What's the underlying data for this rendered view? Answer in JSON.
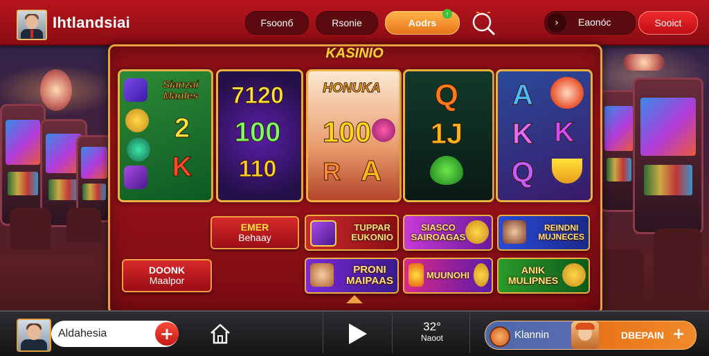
{
  "header": {
    "brand": "Ihtlandsiai",
    "nav": [
      {
        "label": "Fsoonб"
      },
      {
        "label": "Rsonie"
      },
      {
        "label": "Aodrs"
      }
    ],
    "right_button": "Eaonóc",
    "cta_button": "Sooict"
  },
  "panel": {
    "title": "KASINIO",
    "slots": [
      {
        "title": "Sianzai Manles",
        "symbols": [
          "2",
          "K"
        ]
      },
      {
        "symbols": [
          "7120",
          "100",
          "110"
        ]
      },
      {
        "title": "HONUKA",
        "symbols": [
          "100",
          "R",
          "A"
        ]
      },
      {
        "symbols": [
          "Q",
          "1J"
        ]
      },
      {
        "symbols": [
          "A",
          "K",
          "K",
          "Q"
        ]
      }
    ],
    "buttons": [
      {
        "line1": "EMER",
        "line2": "Behaay"
      },
      {
        "line1": "DOONK",
        "line2": "Maalpor"
      }
    ],
    "tiles": [
      {
        "line1": "TUPPAR",
        "line2": "EUKONIO"
      },
      {
        "line1": "SIASCO",
        "line2": "SAIROAGAS"
      },
      {
        "line1": "REINDNI",
        "line2": "MUJNECES"
      },
      {
        "line1": "PRONI",
        "line2": "MAIPAAS"
      },
      {
        "line1": "MUUNOHI"
      },
      {
        "line1": "ANIK",
        "line2": "MULIPNES"
      }
    ]
  },
  "footer": {
    "user_name": "Aldahesia",
    "temperature": "32°",
    "temperature_label": "Naoot",
    "deposit_user": "Klannin",
    "deposit_label": "DBEPAIN"
  },
  "colors": {
    "primary_red": "#b8141c",
    "gold_border": "#e8a040",
    "accent_orange": "#e8741a",
    "title_gold": "#ffcf3a"
  }
}
